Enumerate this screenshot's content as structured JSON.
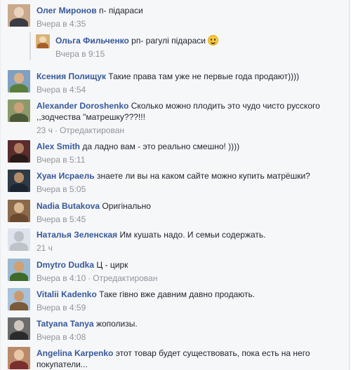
{
  "comments": [
    {
      "name": "Олег Миронов",
      "text": "п- підараси",
      "time": "Вчера в 4:35",
      "edited": ""
    },
    {
      "name": "Ольга Фильченко",
      "text": "рп- рагулі підараси",
      "time": "Вчера в 9:15",
      "edited": ""
    },
    {
      "name": "Ксения Полищук",
      "text": "Такие права там уже не первые года продают))))",
      "time": "Вчера в 4:54",
      "edited": ""
    },
    {
      "name": "Alexander Doroshenko",
      "text": "Сколько можно плодить это чудо чисто русского ,,зодчества \"матрешку???!!!",
      "time": "23 ч",
      "edited": "Отредактирован"
    },
    {
      "name": "Alex Smith",
      "text": "да ладно вам - это реально смешно! ))))",
      "time": "Вчера в 5:11",
      "edited": ""
    },
    {
      "name": "Хуан Исраель",
      "text": "знаете ли вы на каком сайте можно купить матрёшки?",
      "time": "Вчера в 5:05",
      "edited": ""
    },
    {
      "name": "Nadia Butakova",
      "text": "Оригінально",
      "time": "Вчера в 5:45",
      "edited": ""
    },
    {
      "name": "Наталья Зеленская",
      "text": "Им кушать надо. И семьи содержать.",
      "time": "21 ч",
      "edited": ""
    },
    {
      "name": "Dmytro Dudka",
      "text": "Ц - цирк",
      "time": "Вчера в 4:10",
      "edited": "Отредактирован"
    },
    {
      "name": "Vitalii Kadenko",
      "text": "Таке гівно вже давним давно продають.",
      "time": "Вчера в 4:59",
      "edited": ""
    },
    {
      "name": "Tatyana Tanya",
      "text": "жополизы.",
      "time": "Вчера в 4:08",
      "edited": ""
    },
    {
      "name": "Angelina Karpenko",
      "text": "этот товар будет существовать, пока есть на него покупатели...",
      "time": "",
      "edited": ""
    }
  ],
  "colors": {
    "link": "#365899",
    "meta": "#90949c",
    "background": "#f6f7f9"
  }
}
